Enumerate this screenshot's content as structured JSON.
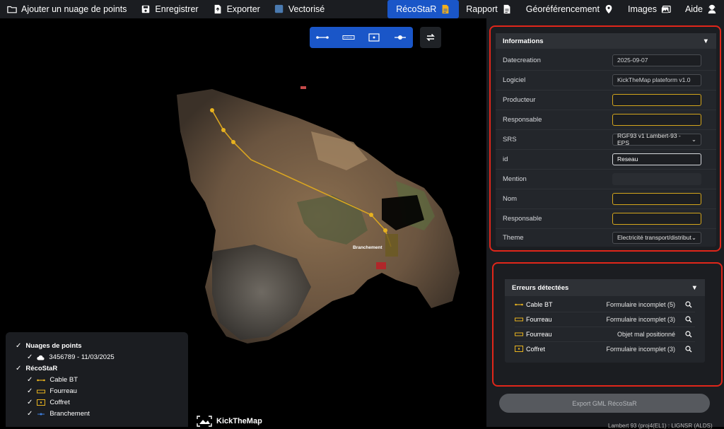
{
  "toolbar": {
    "add_cloud": "Ajouter un nuage de points",
    "save": "Enregistrer",
    "export": "Exporter",
    "vectorized": "Vectorisé",
    "recostar": "RécoStaR",
    "report": "Rapport",
    "georef": "Géoréférencement",
    "images": "Images",
    "help": "Aide"
  },
  "viewer": {
    "label": "Branchement",
    "tools": [
      "line-tool-icon",
      "conduit-tool-icon",
      "box-tool-icon",
      "point-tool-icon"
    ]
  },
  "layers": {
    "clouds_title": "Nuages de points",
    "cloud_item": "3456789 - 11/03/2025",
    "recostar_title": "RécoStaR",
    "items": [
      "Cable BT",
      "Fourreau",
      "Coffret",
      "Branchement"
    ]
  },
  "logo_text": "KickTheMap",
  "info": {
    "title": "Informations",
    "fields": [
      {
        "label": "Datecreation",
        "value": "2025-09-07"
      },
      {
        "label": "Logiciel",
        "value": "KickTheMap plateform v1.0"
      },
      {
        "label": "Producteur",
        "value": ""
      },
      {
        "label": "Responsable",
        "value": ""
      },
      {
        "label": "SRS",
        "value": "RGF93 v1 Lambert-93 - EPS"
      },
      {
        "label": "id",
        "value": "Reseau"
      },
      {
        "label": "Mention",
        "value": ""
      },
      {
        "label": "Nom",
        "value": ""
      },
      {
        "label": "Responsable",
        "value": ""
      },
      {
        "label": "Theme",
        "value": "Electricité transport/distributio"
      }
    ]
  },
  "errors": {
    "title": "Erreurs détectées",
    "rows": [
      {
        "name": "Cable BT",
        "msg": "Formulaire incomplet (5)"
      },
      {
        "name": "Fourreau",
        "msg": "Formulaire incomplet (3)"
      },
      {
        "name": "Fourreau",
        "msg": "Objet mal positionné"
      },
      {
        "name": "Coffret",
        "msg": "Formulaire incomplet (3)"
      }
    ]
  },
  "export_label": "Export GML RécoStaR",
  "coords": "Lambert 93 (proj4(EL1) : LIGNSR (ALDS)",
  "colors": {
    "accent": "#1a56c8",
    "warning": "#d3a51c",
    "highlight": "#e0261a"
  }
}
